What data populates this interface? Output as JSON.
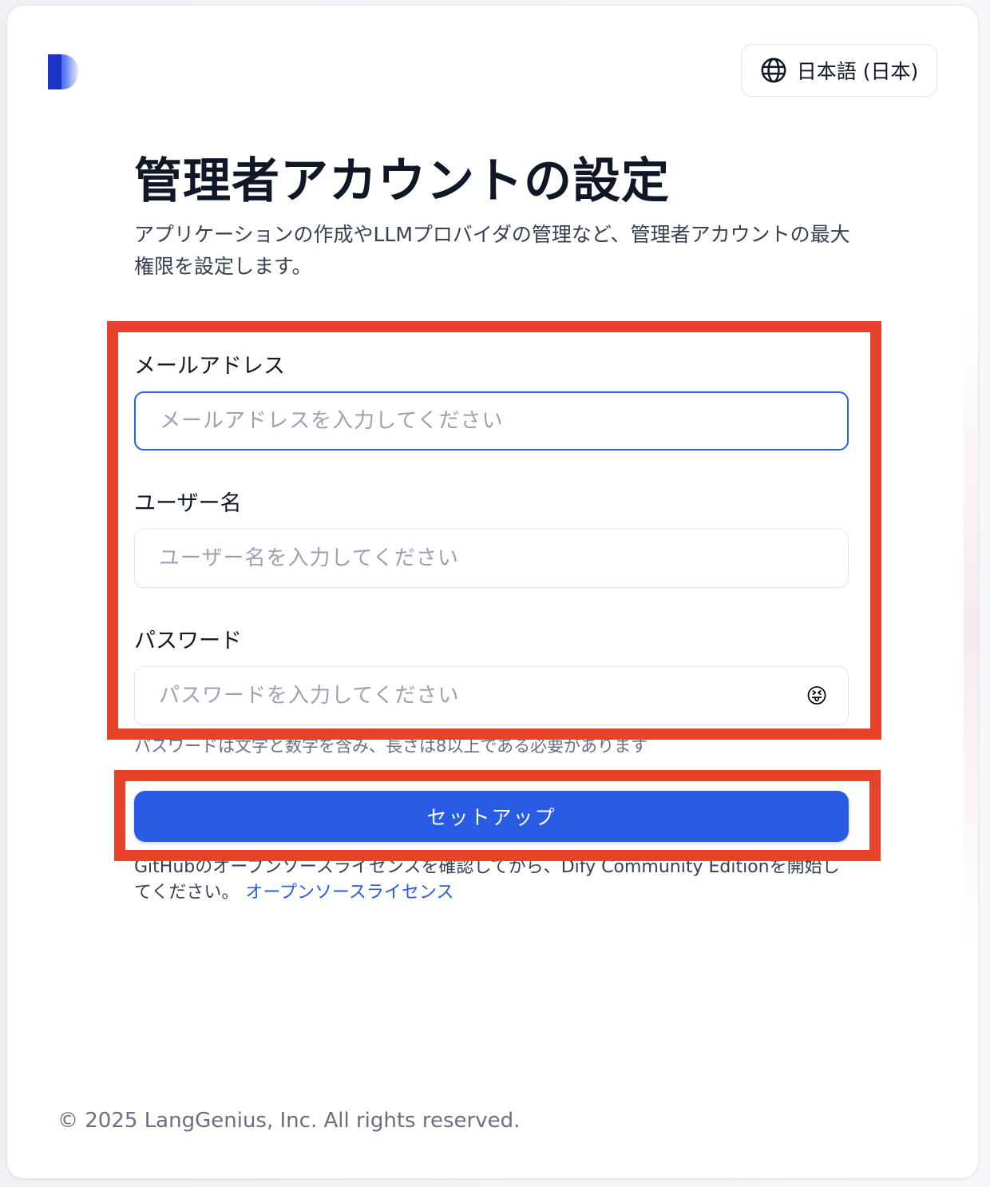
{
  "header": {
    "language": "日本語 (日本)",
    "language_icon": "globe-icon"
  },
  "main": {
    "title": "管理者アカウントの設定",
    "subtitle": "アプリケーションの作成やLLMプロバイダの管理など、管理者アカウントの最大権限を設定します。"
  },
  "form": {
    "email": {
      "label": "メールアドレス",
      "placeholder": "メールアドレスを入力してください",
      "value": ""
    },
    "username": {
      "label": "ユーザー名",
      "placeholder": "ユーザー名を入力してください",
      "value": ""
    },
    "password": {
      "label": "パスワード",
      "placeholder": "パスワードを入力してください",
      "value": "",
      "toggle_icon": "😝",
      "hint": "パスワードは文字と数字を含み、長さは8以上である必要があります"
    },
    "submit_label": "セットアップ"
  },
  "license": {
    "text": "GitHubのオープンソースライセンスを確認してから、Dify Community Editionを開始してください。",
    "link": "オープンソースライセンス"
  },
  "footer": {
    "copyright": "© 2025 LangGenius, Inc. All rights reserved."
  },
  "colors": {
    "accent": "#2a5be4",
    "highlight": "#e8432a"
  }
}
